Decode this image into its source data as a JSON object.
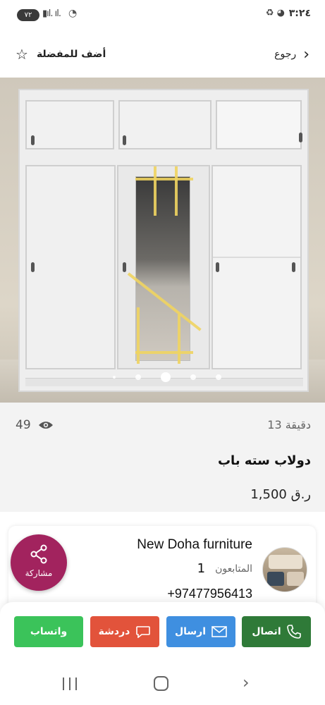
{
  "status_bar": {
    "battery": "٧٢",
    "time": "٣:٢٤"
  },
  "header": {
    "favorite_label": "أضف للمفضلة",
    "back_label": "رجوع"
  },
  "gallery": {
    "image_count": 5,
    "active_index": 2
  },
  "listing": {
    "views": "49",
    "posted_ago": "13 دقيقة",
    "title": "دولاب سته باب",
    "price": "1,500 ر.ق"
  },
  "seller": {
    "name": "New Doha furniture",
    "followers_label": "المتابعون",
    "followers_count": "1",
    "phone": "+97477956413",
    "share_label": "مشاركة"
  },
  "actions": {
    "whatsapp_label": "واتساب",
    "chat_label": "دردشة",
    "send_label": "ارسال",
    "call_label": "اتصال"
  },
  "colors": {
    "share": "#a2235e",
    "whatsapp": "#3bc35a",
    "chat": "#e2533b",
    "send": "#3f8fe0",
    "call": "#2f7a38"
  }
}
